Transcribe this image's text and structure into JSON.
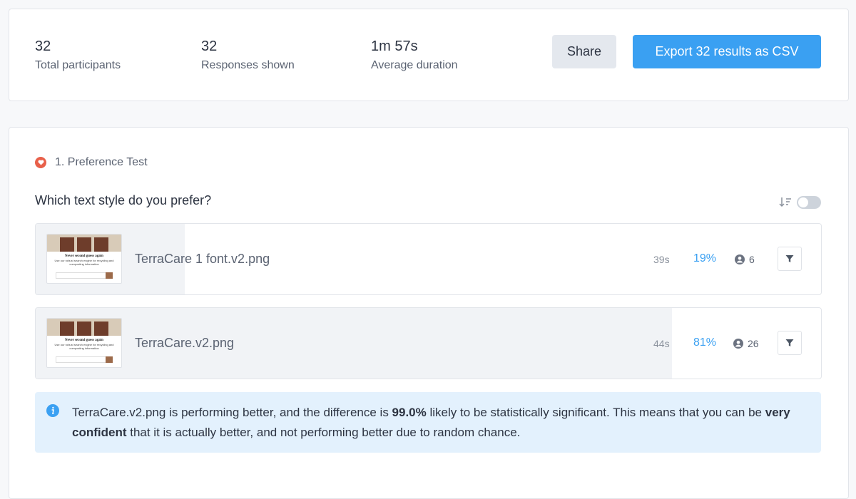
{
  "stats": {
    "total_participants": {
      "value": "32",
      "label": "Total participants"
    },
    "responses_shown": {
      "value": "32",
      "label": "Responses shown"
    },
    "average_duration": {
      "value": "1m 57s",
      "label": "Average duration"
    }
  },
  "actions": {
    "share_label": "Share",
    "export_label": "Export 32 results as CSV"
  },
  "section": {
    "title": "1. Preference Test",
    "question": "Which text style do you prefer?",
    "options": [
      {
        "name": "TerraCare 1 font.v2.png",
        "time": "39s",
        "percent": "19%",
        "percent_value": 19,
        "count": "6",
        "thumb_title": "Never second guess again",
        "thumb_text": "Use our robust search engine for recycling and composting information"
      },
      {
        "name": "TerraCare.v2.png",
        "time": "44s",
        "percent": "81%",
        "percent_value": 81,
        "count": "26",
        "thumb_title": "Never second guess again",
        "thumb_text": "Use our robust search engine for recycling and composting information"
      }
    ],
    "info": {
      "part1": "TerraCare.v2.png is performing better, and the difference is ",
      "bold1": "99.0%",
      "part2": " likely to be statistically significant. This means that you can be ",
      "bold2": "very confident",
      "part3": " that it is actually better, and not performing better due to random chance."
    }
  },
  "colors": {
    "accent": "#3aa0f2",
    "badge": "#e8604a",
    "info_bg": "#e3f1fd"
  }
}
